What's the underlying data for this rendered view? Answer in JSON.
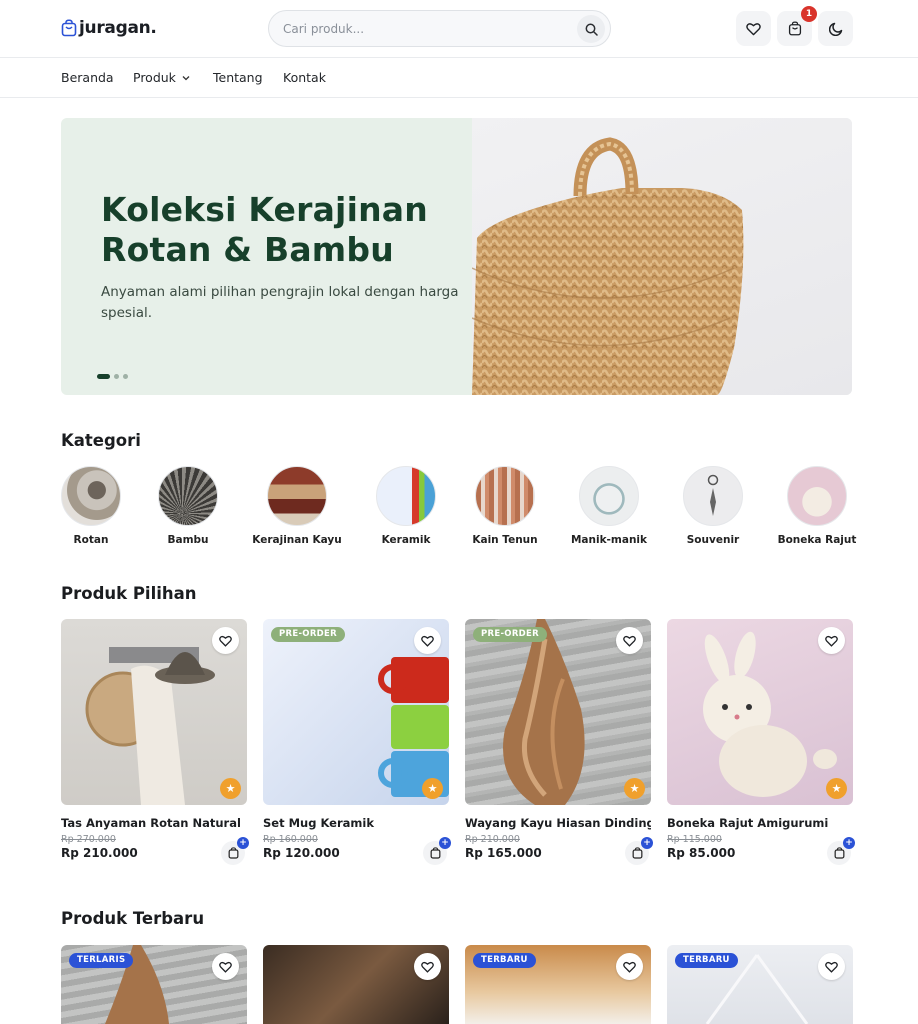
{
  "brand": {
    "name": "juragan."
  },
  "search": {
    "placeholder": "Cari produk..."
  },
  "header": {
    "cart_count": "1"
  },
  "nav": {
    "items": [
      "Beranda",
      "Produk",
      "Tentang",
      "Kontak"
    ]
  },
  "hero": {
    "title_line1": "Koleksi Kerajinan",
    "title_line2": "Rotan & Bambu",
    "subtitle": "Anyaman alami pilihan pengrajin lokal dengan harga spesial.",
    "slide_count": 3,
    "active_slide": 1
  },
  "categories": {
    "title": "Kategori",
    "items": [
      "Rotan",
      "Bambu",
      "Kerajinan Kayu",
      "Keramik",
      "Kain Tenun",
      "Manik-manik",
      "Souvenir",
      "Boneka Rajut"
    ]
  },
  "featured": {
    "title": "Produk Pilihan",
    "products": [
      {
        "name": "Tas Anyaman Rotan Natural",
        "old_price": "Rp 270.000",
        "price": "Rp 210.000",
        "tag": ""
      },
      {
        "name": "Set Mug Keramik",
        "old_price": "Rp 160.000",
        "price": "Rp 120.000",
        "tag": "PRE-ORDER"
      },
      {
        "name": "Wayang Kayu Hiasan Dinding",
        "old_price": "Rp 210.000",
        "price": "Rp 165.000",
        "tag": "PRE-ORDER"
      },
      {
        "name": "Boneka Rajut Amigurumi",
        "old_price": "Rp 115.000",
        "price": "Rp 85.000",
        "tag": ""
      }
    ]
  },
  "latest": {
    "title": "Produk Terbaru",
    "tags": [
      "TERLARIS",
      "",
      "TERBARU",
      "TERBARU"
    ]
  },
  "colors": {
    "primary": "#17402b",
    "hero_bg": "#e7f0e9",
    "badge": "#d9342b",
    "accent_blue": "#2b52d6",
    "preorder": "#8eb07a",
    "star": "#f0a02c"
  }
}
